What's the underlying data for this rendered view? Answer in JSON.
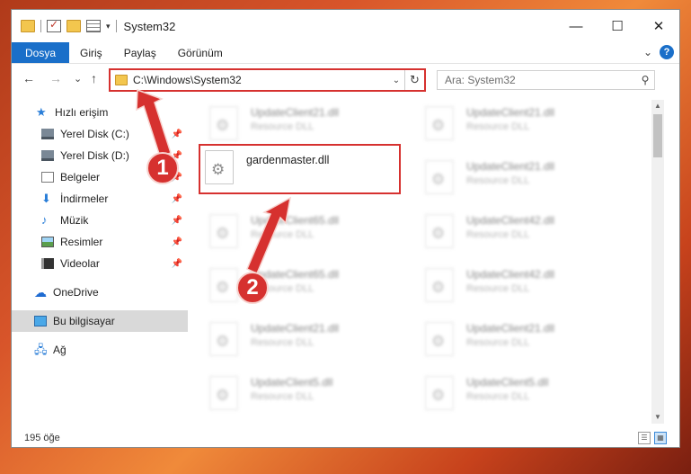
{
  "window": {
    "title": "System32",
    "controls": {
      "minimize": "—",
      "maximize": "☐",
      "close": "✕"
    }
  },
  "ribbon": {
    "tabs": [
      {
        "label": "Dosya",
        "active": true
      },
      {
        "label": "Giriş"
      },
      {
        "label": "Paylaş"
      },
      {
        "label": "Görünüm"
      }
    ],
    "expand": "⌄",
    "help": "?"
  },
  "nav": {
    "back": "←",
    "forward": "→",
    "recent": "⌄",
    "up": "↑"
  },
  "address": {
    "path": "C:\\Windows\\System32",
    "dropdown": "⌄",
    "refresh": "↻"
  },
  "search": {
    "placeholder": "Ara: System32",
    "icon": "search-icon"
  },
  "sidebar": {
    "items": [
      {
        "label": "Hızlı erişim",
        "icon": "star-icon"
      },
      {
        "label": "Yerel Disk (C:)",
        "icon": "drive-icon",
        "pinned": true
      },
      {
        "label": "Yerel Disk (D:)",
        "icon": "drive-icon",
        "pinned": true
      },
      {
        "label": "Belgeler",
        "icon": "documents-icon",
        "pinned": true
      },
      {
        "label": "İndirmeler",
        "icon": "download-icon",
        "pinned": true
      },
      {
        "label": "Müzik",
        "icon": "music-icon",
        "pinned": true
      },
      {
        "label": "Resimler",
        "icon": "pictures-icon",
        "pinned": true
      },
      {
        "label": "Videolar",
        "icon": "videos-icon",
        "pinned": true
      },
      {
        "label": "OneDrive",
        "icon": "cloud-icon"
      },
      {
        "label": "Bu bilgisayar",
        "icon": "computer-icon",
        "selected": true
      },
      {
        "label": "Ağ",
        "icon": "network-icon"
      }
    ]
  },
  "files": {
    "highlighted": {
      "name": "gardenmaster.dll"
    },
    "blurred": [
      {
        "name": "UpdateClient21.dll",
        "desc": "Resource DLL"
      },
      {
        "name": "UpdateClient21.dll",
        "desc": "Resource DLL"
      },
      {
        "name": "UpdateClient21.dll",
        "desc": "Resource DLL"
      },
      {
        "name": "UpdateClient65.dll",
        "desc": "Resource DLL"
      },
      {
        "name": "UpdateClient42.dll",
        "desc": "Resource DLL"
      },
      {
        "name": "UpdateClient65.dll",
        "desc": "Resource DLL"
      },
      {
        "name": "UpdateClient42.dll",
        "desc": "Resource DLL"
      },
      {
        "name": "UpdateClient21.dll",
        "desc": "Resource DLL"
      },
      {
        "name": "UpdateClient21.dll",
        "desc": "Resource DLL"
      },
      {
        "name": "UpdateClient5.dll",
        "desc": "Resource DLL"
      },
      {
        "name": "UpdateClient5.dll",
        "desc": "Resource DLL"
      }
    ]
  },
  "status": {
    "count": "195 öğe"
  },
  "annotations": {
    "step1": "1",
    "step2": "2",
    "color": "#d6312f"
  }
}
